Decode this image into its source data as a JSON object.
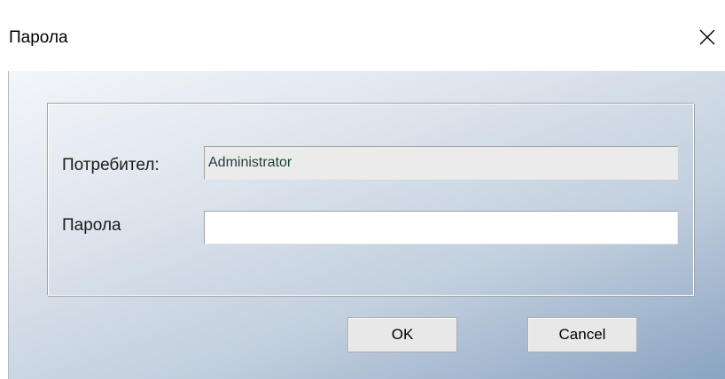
{
  "window": {
    "title": "Парола",
    "close_icon": "close-icon"
  },
  "form": {
    "user_label": "Потребител:",
    "user_value": "Administrator",
    "password_label": "Парола",
    "password_value": ""
  },
  "buttons": {
    "ok_label": "OK",
    "cancel_label": "Cancel"
  },
  "colors": {
    "background_gradient_start": "#f3f6fa",
    "background_gradient_end": "#8aa4c2",
    "readonly_field_bg": "#ebebeb",
    "button_bg": "#e8e8e8"
  }
}
